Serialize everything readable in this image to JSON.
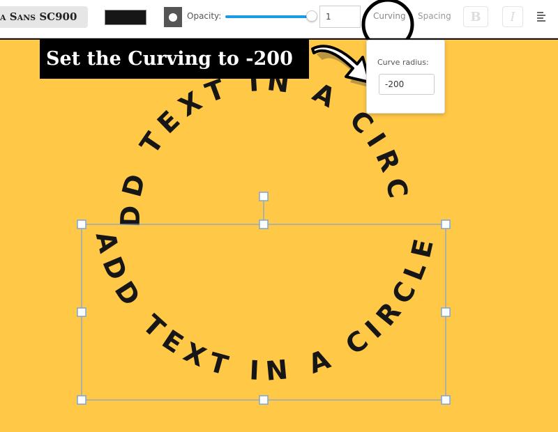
{
  "toolbar": {
    "font_name": "a Sans SC900",
    "text_color": "#161616",
    "opacity_label": "Opacity:",
    "opacity_value": "1",
    "opacity_fraction": 1.0,
    "tabs": {
      "curving": "Curving",
      "spacing": "Spacing"
    },
    "bold_label": "B",
    "italic_label": "I"
  },
  "callout": {
    "text": "Set the Curving to -200"
  },
  "popover": {
    "label": "Curve radius:",
    "value": "-200"
  },
  "canvas": {
    "background_color": "#ffc846",
    "text_color": "#161616",
    "top_text": "ADD TEXT IN A CIRCLE",
    "bottom_text": "ADD TEXT IN A CIRCLE",
    "selection_color": "#7aa5d9"
  }
}
